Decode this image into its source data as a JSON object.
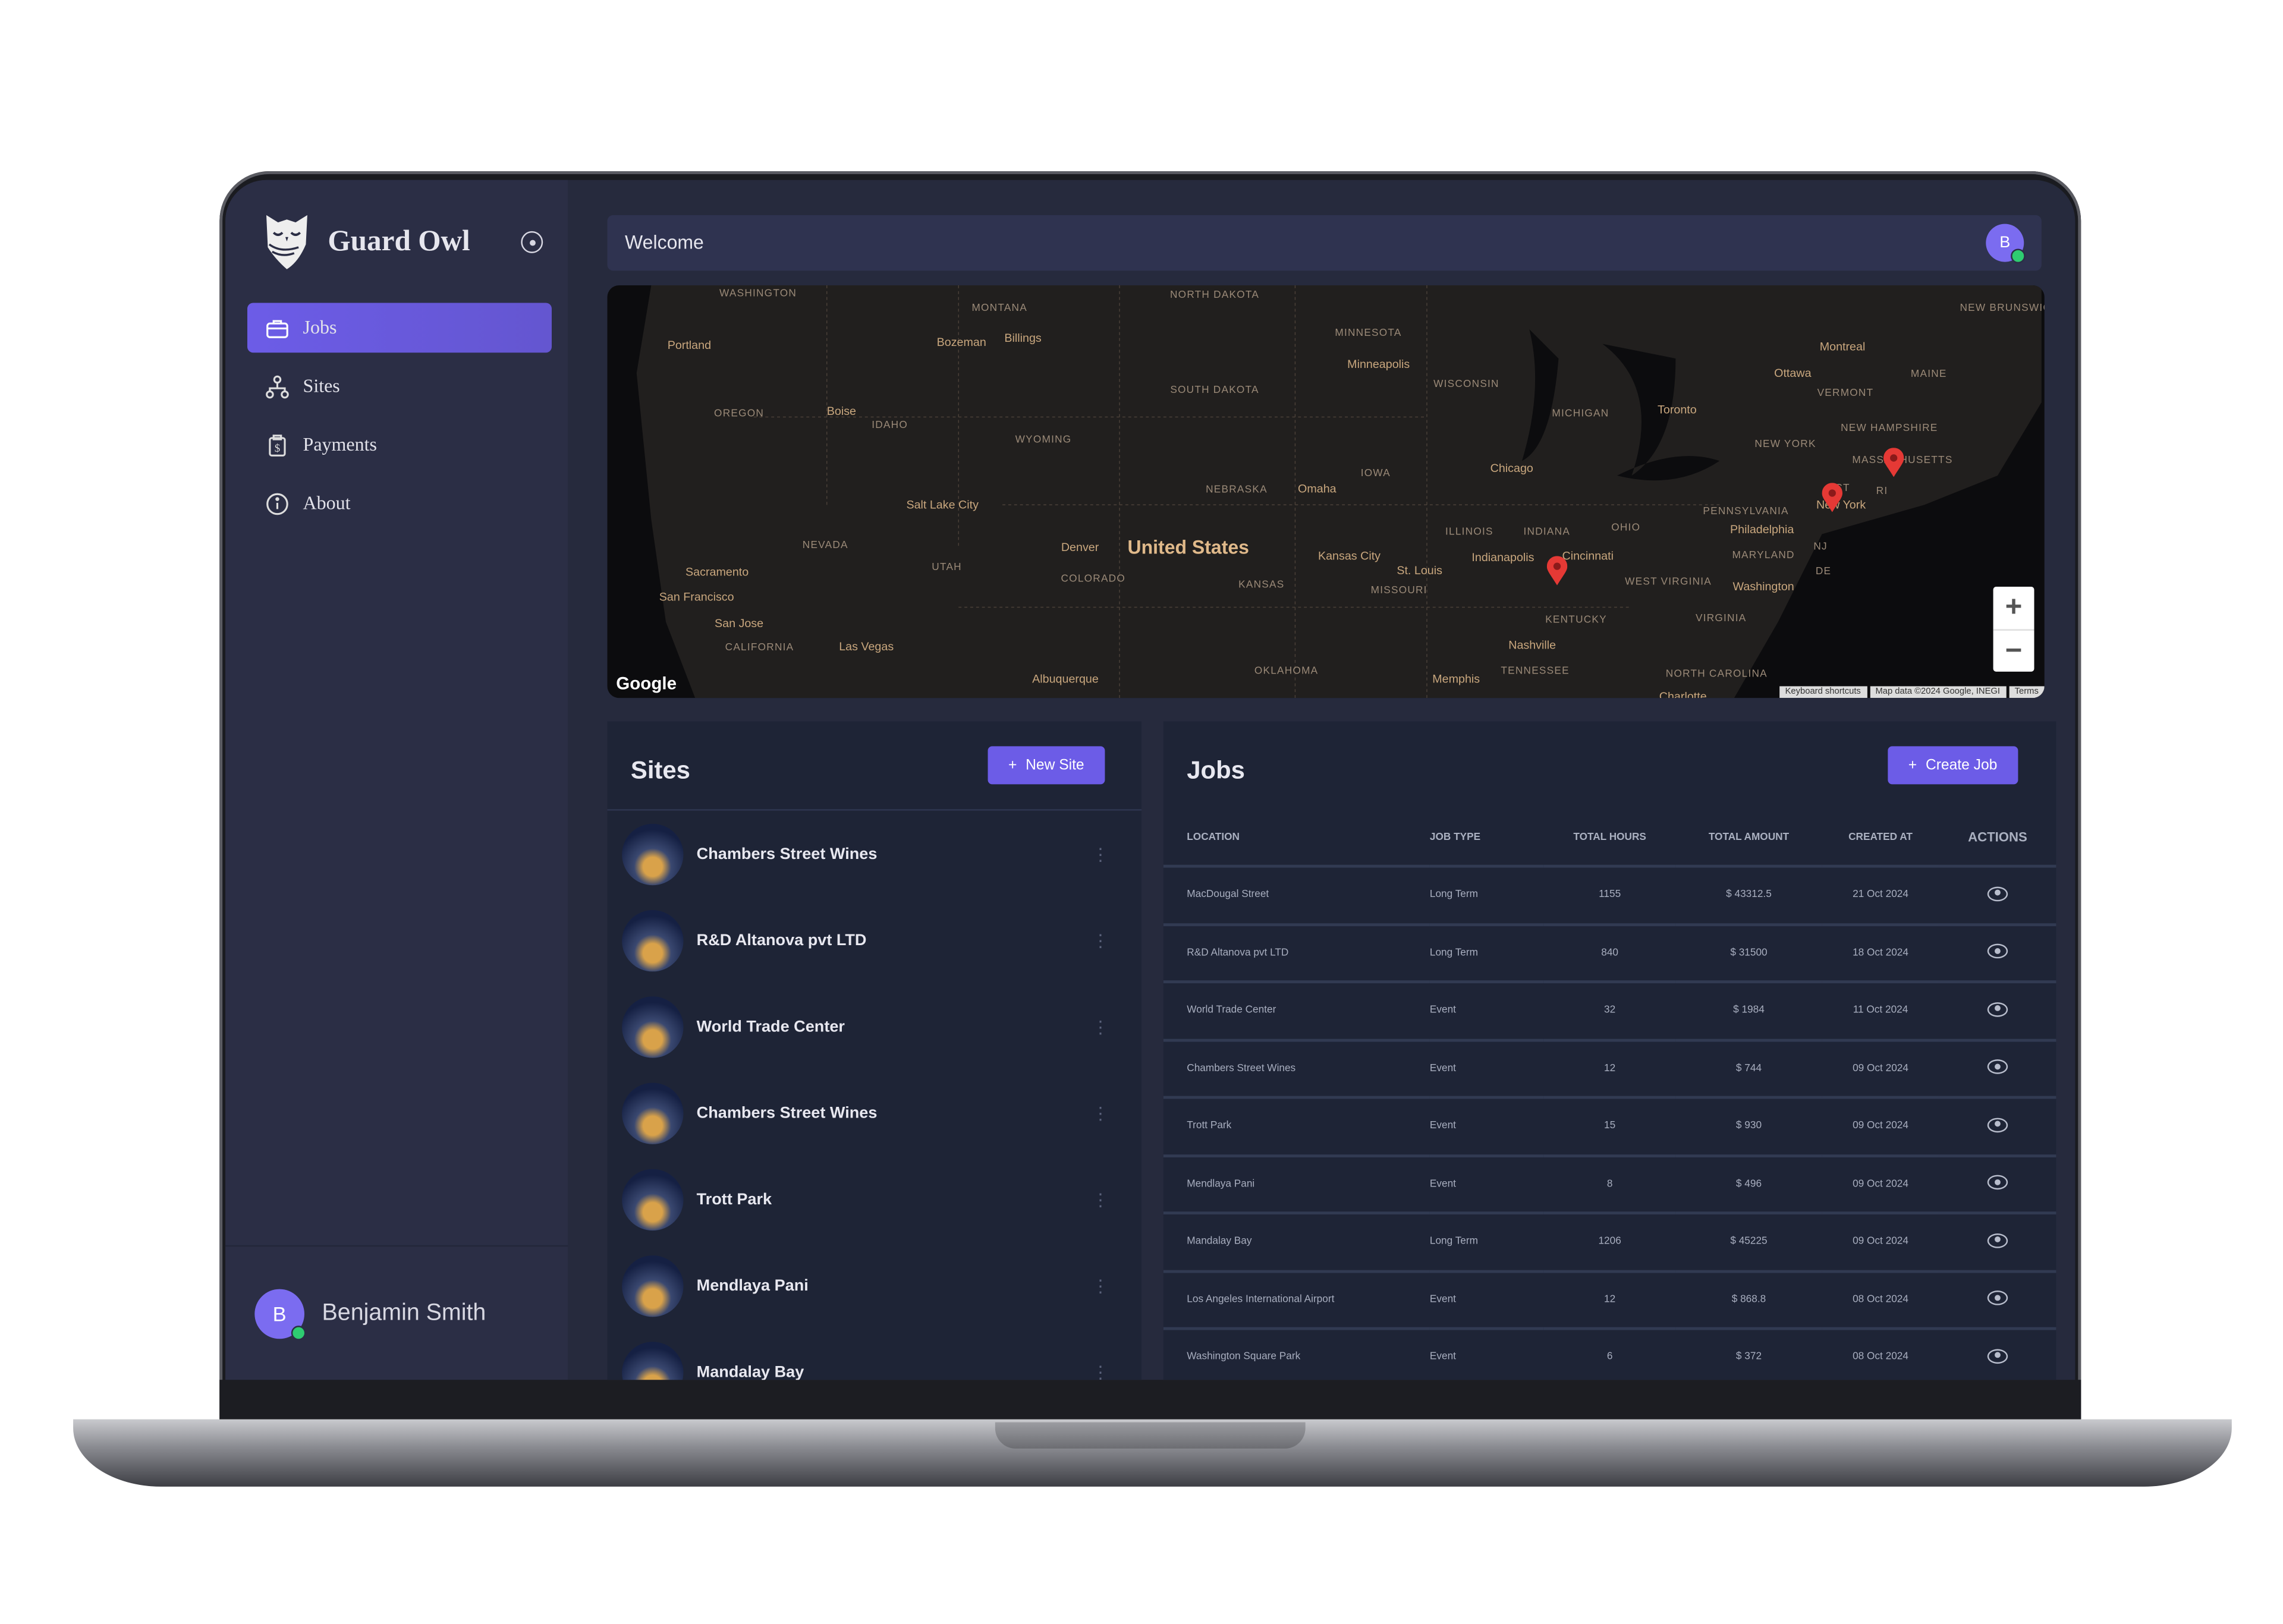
{
  "app": {
    "name": "Guard Owl"
  },
  "sidebar": {
    "items": [
      {
        "label": "Jobs",
        "icon": "briefcase-icon",
        "active": true
      },
      {
        "label": "Sites",
        "icon": "sitemap-icon"
      },
      {
        "label": "Payments",
        "icon": "clipboard-dollar-icon"
      },
      {
        "label": "About",
        "icon": "info-icon"
      }
    ]
  },
  "user": {
    "initial": "B",
    "name": "Benjamin Smith",
    "status_color": "#2ecc71"
  },
  "header": {
    "title": "Welcome",
    "avatar_initial": "B"
  },
  "map": {
    "provider": "Google",
    "country_label": "United States",
    "labels": [
      "WASHINGTON",
      "MONTANA",
      "NORTH DAKOTA",
      "MINNESOTA",
      "Portland",
      "Bozeman",
      "Billings",
      "SOUTH DAKOTA",
      "Minneapolis",
      "WISCONSIN",
      "MICHIGAN",
      "Toronto",
      "Ottawa",
      "Montreal",
      "VERMONT",
      "MAINE",
      "NEW BRUNSWICK",
      "OREGON",
      "Boise",
      "IDAHO",
      "WYOMING",
      "NEW HAMPSHIRE",
      "NEW YORK",
      "MASSACHUSETTS",
      "IOWA",
      "NEBRASKA",
      "Omaha",
      "Chicago",
      "CT",
      "RI",
      "Salt Lake City",
      "PENNSYLVANIA",
      "New York",
      "NEVADA",
      "UTAH",
      "Denver",
      "ILLINOIS",
      "INDIANA",
      "OHIO",
      "Philadelphia",
      "NJ",
      "Kansas City",
      "Indianapolis",
      "Cincinnati",
      "MARYLAND",
      "Sacramento",
      "COLORADO",
      "KANSAS",
      "St. Louis",
      "MISSOURI",
      "WEST VIRGINIA",
      "DE",
      "Washington",
      "San Francisco",
      "San Jose",
      "KENTUCKY",
      "VIRGINIA",
      "CALIFORNIA",
      "Las Vegas",
      "Nashville",
      "Albuquerque",
      "OKLAHOMA",
      "TENNESSEE",
      "Memphis",
      "NORTH CAROLINA",
      "Charlotte"
    ],
    "zoom_in": "+",
    "zoom_out": "−",
    "credits": [
      "Keyboard shortcuts",
      "Map data ©2024 Google, INEGI",
      "Terms"
    ],
    "marker_color": "#e53935"
  },
  "sites": {
    "title": "Sites",
    "new_button": "New Site",
    "items": [
      "Chambers Street Wines",
      "R&D Altanova pvt LTD",
      "World Trade Center",
      "Chambers Street Wines",
      "Trott Park",
      "Mendlaya Pani",
      "Mandalay Bay"
    ]
  },
  "jobs": {
    "title": "Jobs",
    "create_button": "Create Job",
    "columns": [
      "LOCATION",
      "JOB TYPE",
      "TOTAL HOURS",
      "TOTAL AMOUNT",
      "CREATED AT",
      "ACTIONS"
    ],
    "rows": [
      [
        "MacDougal Street",
        "Long Term",
        "1155",
        "$ 43312.5",
        "21 Oct 2024"
      ],
      [
        "R&D Altanova pvt LTD",
        "Long Term",
        "840",
        "$ 31500",
        "18 Oct 2024"
      ],
      [
        "World Trade Center",
        "Event",
        "32",
        "$ 1984",
        "11 Oct 2024"
      ],
      [
        "Chambers Street Wines",
        "Event",
        "12",
        "$ 744",
        "09 Oct 2024"
      ],
      [
        "Trott Park",
        "Event",
        "15",
        "$ 930",
        "09 Oct 2024"
      ],
      [
        "Mendlaya Pani",
        "Event",
        "8",
        "$ 496",
        "09 Oct 2024"
      ],
      [
        "Mandalay Bay",
        "Long Term",
        "1206",
        "$ 45225",
        "09 Oct 2024"
      ],
      [
        "Los Angeles International Airport",
        "Event",
        "12",
        "$ 868.8",
        "08 Oct 2024"
      ],
      [
        "Washington Square Park",
        "Event",
        "6",
        "$ 372",
        "08 Oct 2024"
      ]
    ]
  },
  "colors": {
    "accent": "#6c5ce7",
    "sidebar": "#2b2e45",
    "panel": "#1e2436"
  }
}
